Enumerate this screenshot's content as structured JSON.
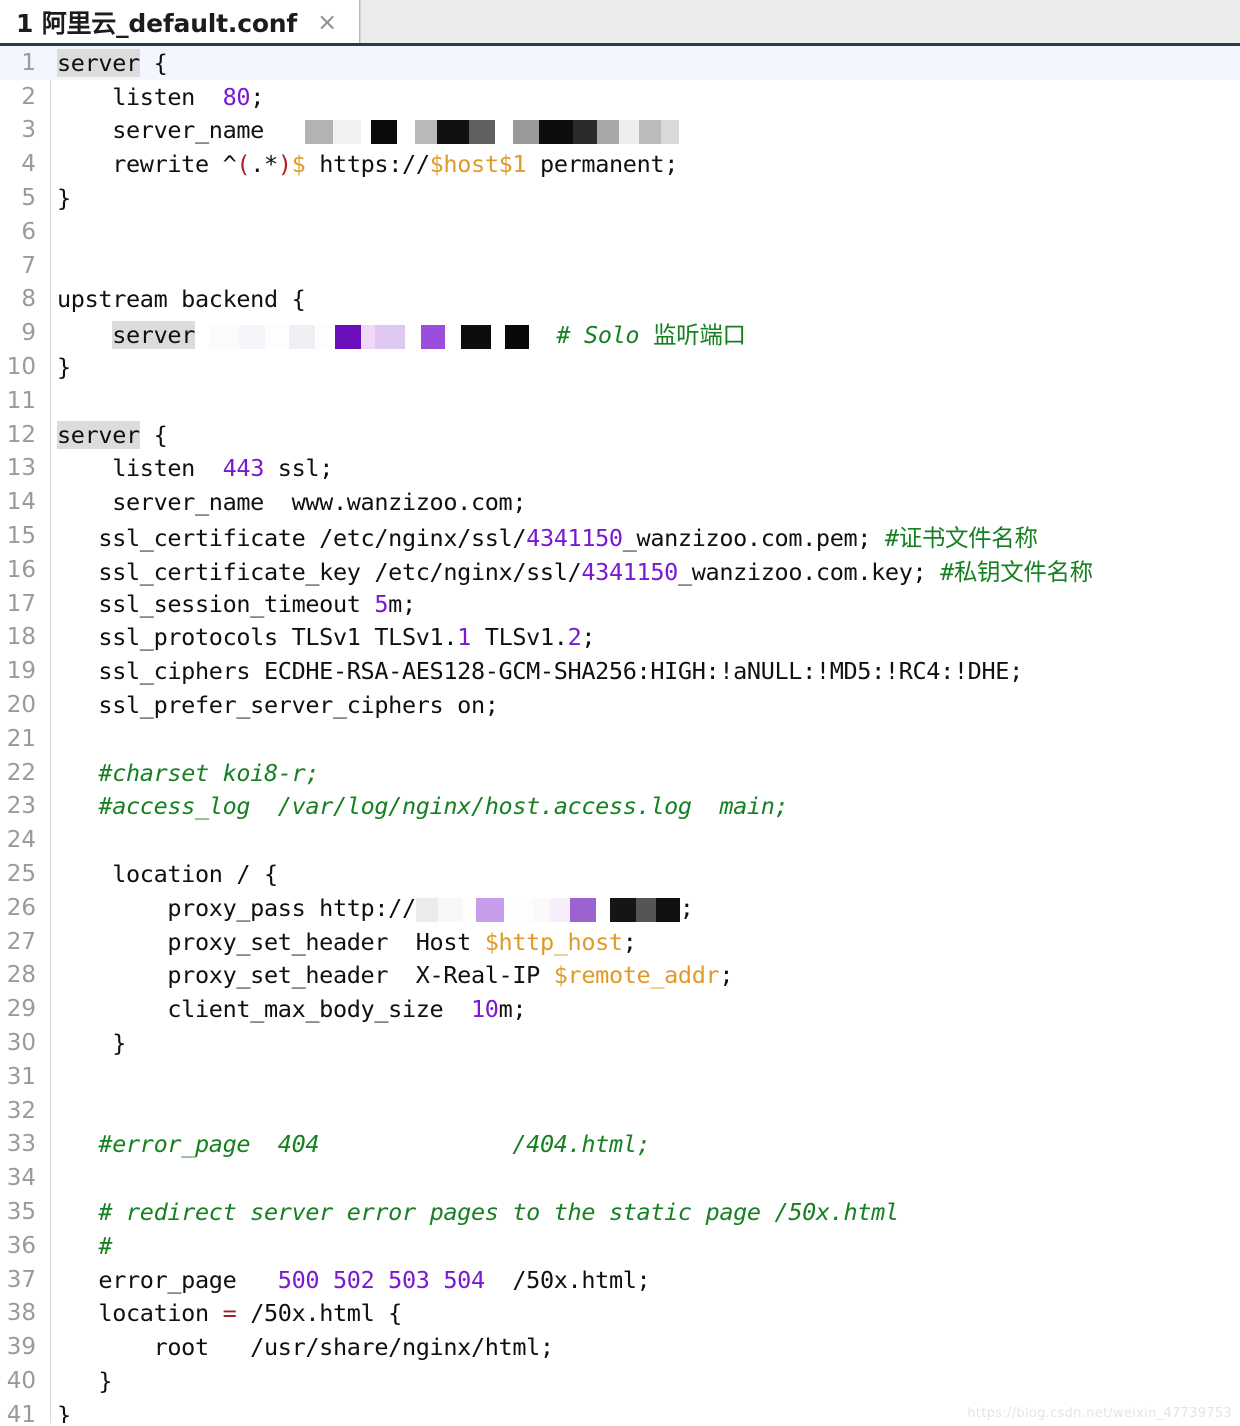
{
  "tab": {
    "title": "1 阿里云_default.conf",
    "close_label": "×"
  },
  "editor": {
    "watermark": "https://blog.csdn.net/weixin_47739753",
    "lines": [
      {
        "n": "1",
        "text": "server {"
      },
      {
        "n": "2",
        "text": "    listen  80;"
      },
      {
        "n": "3",
        "text": "    server_name   [REDACTED]"
      },
      {
        "n": "4",
        "text": "    rewrite ^(.*)$ https://$host$1 permanent;"
      },
      {
        "n": "5",
        "text": "}"
      },
      {
        "n": "6",
        "text": ""
      },
      {
        "n": "7",
        "text": ""
      },
      {
        "n": "8",
        "text": "upstream backend {"
      },
      {
        "n": "9",
        "text": "    server  [REDACTED]  # Solo 监听端口"
      },
      {
        "n": "10",
        "text": "}"
      },
      {
        "n": "11",
        "text": ""
      },
      {
        "n": "12",
        "text": "server {"
      },
      {
        "n": "13",
        "text": "    listen  443 ssl;"
      },
      {
        "n": "14",
        "text": "    server_name  www.wanzizoo.com;"
      },
      {
        "n": "15",
        "text": "    ssl_certificate /etc/nginx/ssl/4341150_wanzizoo.com.pem; #证书文件名称"
      },
      {
        "n": "16",
        "text": "    ssl_certificate_key /etc/nginx/ssl/4341150_wanzizoo.com.key; #私钥文件名称"
      },
      {
        "n": "17",
        "text": "    ssl_session_timeout 5m;"
      },
      {
        "n": "18",
        "text": "    ssl_protocols TLSv1 TLSv1.1 TLSv1.2;"
      },
      {
        "n": "19",
        "text": "    ssl_ciphers ECDHE-RSA-AES128-GCM-SHA256:HIGH:!aNULL:!MD5:!RC4:!DHE;"
      },
      {
        "n": "20",
        "text": "    ssl_prefer_server_ciphers on;"
      },
      {
        "n": "21",
        "text": ""
      },
      {
        "n": "22",
        "text": "    #charset koi8-r;"
      },
      {
        "n": "23",
        "text": "    #access_log  /var/log/nginx/host.access.log  main;"
      },
      {
        "n": "24",
        "text": ""
      },
      {
        "n": "25",
        "text": "    location / {"
      },
      {
        "n": "26",
        "text": "        proxy_pass http://[REDACTED];"
      },
      {
        "n": "27",
        "text": "        proxy_set_header  Host $http_host;"
      },
      {
        "n": "28",
        "text": "        proxy_set_header  X-Real-IP $remote_addr;"
      },
      {
        "n": "29",
        "text": "        client_max_body_size  10m;"
      },
      {
        "n": "30",
        "text": "    }"
      },
      {
        "n": "31",
        "text": ""
      },
      {
        "n": "32",
        "text": ""
      },
      {
        "n": "33",
        "text": "    #error_page  404              /404.html;"
      },
      {
        "n": "34",
        "text": ""
      },
      {
        "n": "35",
        "text": "    # redirect server error pages to the static page /50x.html"
      },
      {
        "n": "36",
        "text": "    #"
      },
      {
        "n": "37",
        "text": "    error_page   500 502 503 504  /50x.html;"
      },
      {
        "n": "38",
        "text": "    location = /50x.html {"
      },
      {
        "n": "39",
        "text": "        root   /usr/share/nginx/html;"
      },
      {
        "n": "40",
        "text": "    }"
      },
      {
        "n": "41",
        "text": "}"
      }
    ]
  },
  "colors": {
    "number": "#7a19d1",
    "variable": "#e09a26",
    "comment": "#178022",
    "regex_paren": "#b02020",
    "word_highlight": "#dcdcdc",
    "current_line": "#f3f7fd",
    "tabbar_bg": "#ececec",
    "tabbar_underline": "#2b3a4f"
  }
}
